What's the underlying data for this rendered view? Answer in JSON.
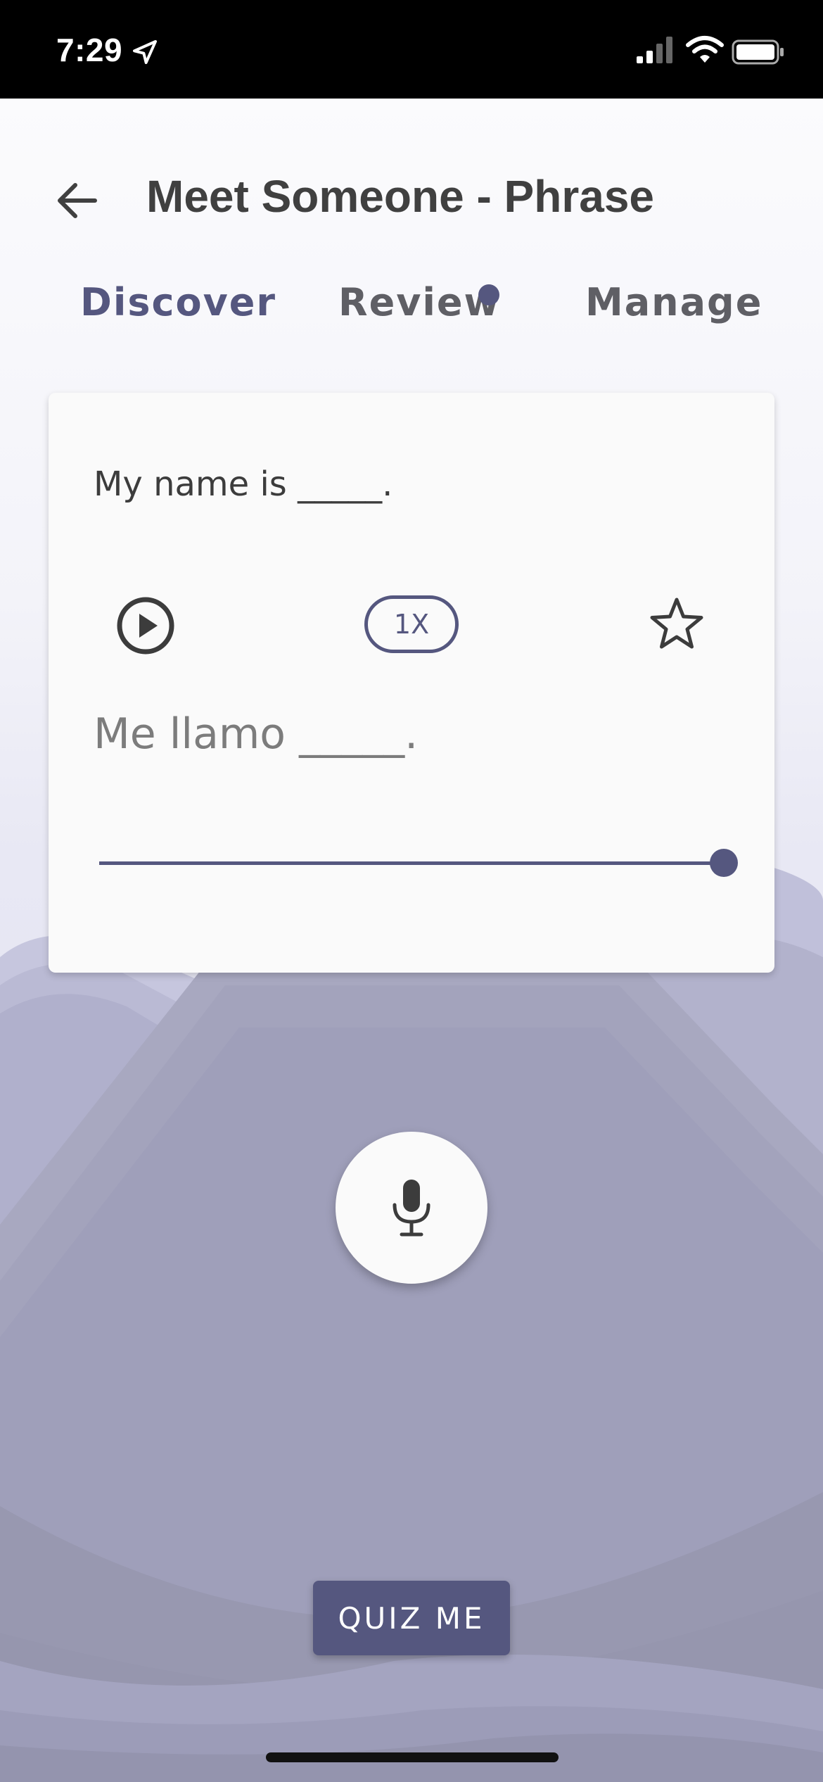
{
  "status_bar": {
    "time": "7:29",
    "icons": [
      "location-arrow-icon",
      "cellular-signal-icon",
      "wifi-icon",
      "battery-icon"
    ]
  },
  "header": {
    "back_icon": "arrow-left-icon",
    "title": "Meet Someone - Phrase"
  },
  "tabs": [
    {
      "label": "Discover",
      "active": true
    },
    {
      "label": "Review",
      "has_notification_dot": true
    },
    {
      "label": "Manage"
    }
  ],
  "card": {
    "phrase_en": "My name is _____.",
    "play_icon": "play-circle-icon",
    "speed_label": "1X",
    "favorite_icon": "star-outline-icon",
    "phrase_es": "Me llamo _____.",
    "playback_progress": 1.0
  },
  "mic_icon": "microphone-icon",
  "quiz_button_label": "QUIZ ME",
  "colors": {
    "accent": "#55577f",
    "title_text": "#404040",
    "card_bg": "#fafafa",
    "mountain_light": "#b8b8d4",
    "mountain_mid": "#a0a0bc",
    "mountain_dark": "#9090aa"
  }
}
